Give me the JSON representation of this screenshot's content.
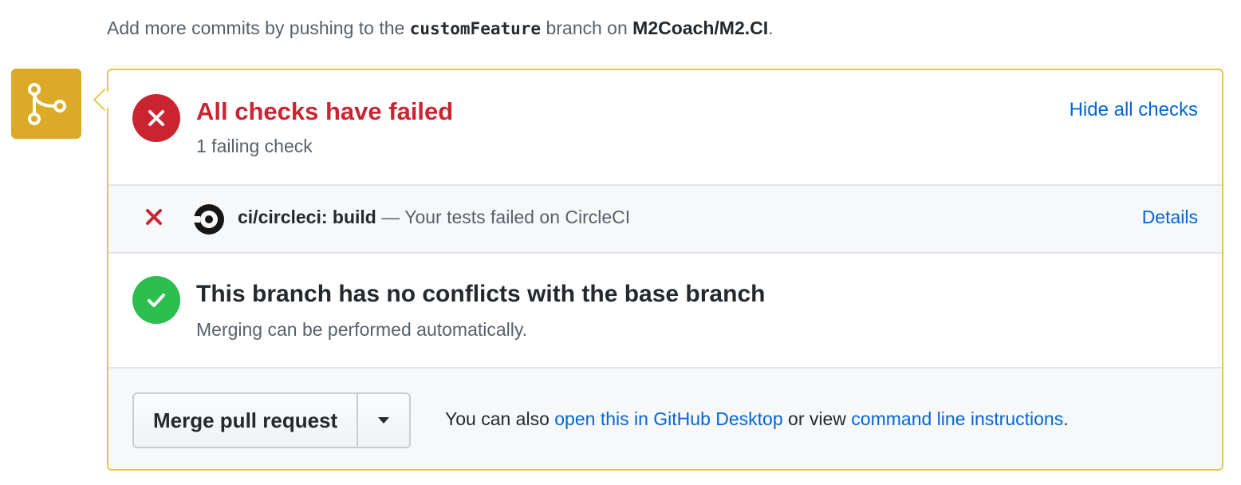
{
  "intro": {
    "prefix": "Add more commits by pushing to the ",
    "branch": "customFeature",
    "middle": " branch on ",
    "repo": "M2Coach/M2.CI",
    "suffix": "."
  },
  "checks": {
    "title": "All checks have failed",
    "subtitle": "1 failing check",
    "toggle_label": "Hide all checks",
    "items": [
      {
        "context": "ci/circleci: build",
        "description": " — Your tests failed on CircleCI",
        "details_label": "Details",
        "status": "failure"
      }
    ]
  },
  "branch_status": {
    "title": "This branch has no conflicts with the base branch",
    "subtitle": "Merging can be performed automatically."
  },
  "merge": {
    "button_label": "Merge pull request",
    "note_prefix": "You can also ",
    "desktop_link": "open this in GitHub Desktop",
    "note_middle": " or view ",
    "cli_link": "command line instructions",
    "note_suffix": "."
  },
  "colors": {
    "failure": "#cb2431",
    "success": "#2cbe4e",
    "pending": "#dbab27",
    "link": "#0366d6"
  },
  "icons": {
    "merge_state": "git-merge-icon",
    "failure": "x-icon",
    "success": "check-icon",
    "provider": "circleci-logo-icon",
    "caret": "triangle-down-icon"
  }
}
